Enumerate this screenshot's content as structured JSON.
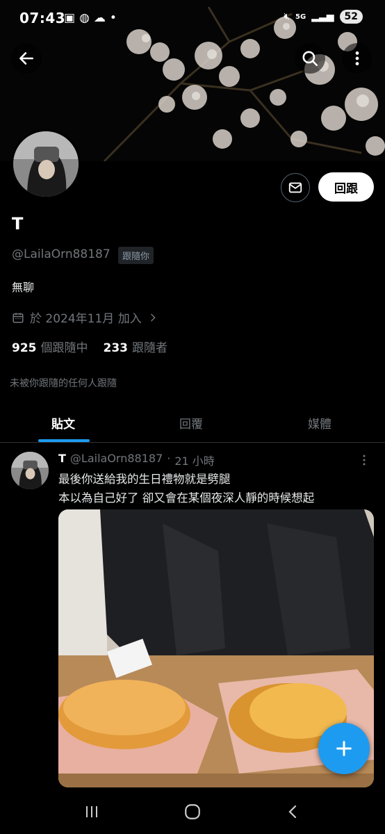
{
  "status_bar": {
    "time": "07:43",
    "signal_label": "5G",
    "battery": "52"
  },
  "profile": {
    "name": "T",
    "handle": "@LailaOrn88187",
    "follows_you_badge": "跟隨你",
    "bio": "無聊",
    "joined": "於 2024年11月 加入",
    "following_count": "925",
    "following_label": "個跟隨中",
    "followers_count": "233",
    "followers_label": "跟隨者",
    "not_followed_note": "未被你跟隨的任何人跟隨",
    "follow_back_label": "回跟"
  },
  "tabs": [
    {
      "label": "貼文",
      "active": true
    },
    {
      "label": "回覆",
      "active": false
    },
    {
      "label": "媒體",
      "active": false
    }
  ],
  "post": {
    "author": "T",
    "handle": "@LailaOrn88187",
    "separator": "·",
    "time": "21 小時",
    "line1": "最後你送給我的生日禮物就是劈腿",
    "line2": "本以為自己好了 卻又會在某個夜深人靜的時候想起"
  },
  "colors": {
    "accent": "#1d9bf0",
    "background": "#000000",
    "muted_text": "#71767b"
  },
  "icons": {
    "back": "back-arrow-icon",
    "search": "search-icon",
    "more": "more-vertical-icon",
    "mail": "mail-icon",
    "calendar": "calendar-icon",
    "chevron": "chevron-right-icon",
    "fab": "plus-icon"
  }
}
